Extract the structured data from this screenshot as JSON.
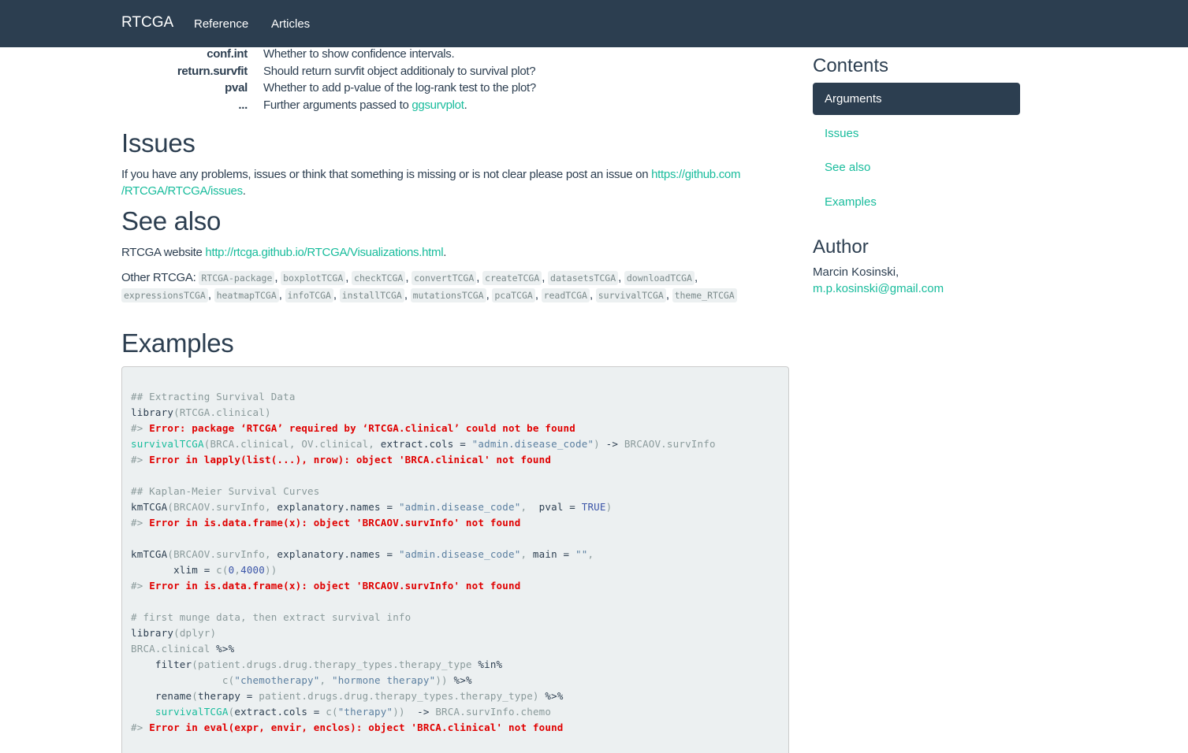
{
  "nav": {
    "brand": "RTCGA",
    "links": [
      "Reference",
      "Articles"
    ]
  },
  "arguments": [
    {
      "name": "conf.int",
      "desc": "Whether to show confidence intervals.",
      "link": ""
    },
    {
      "name": "return.survfit",
      "desc": "Should return survfit object additionaly to survival plot?",
      "link": ""
    },
    {
      "name": "pval",
      "desc": "Whether to add p-value of the log-rank test to the plot?",
      "link": ""
    },
    {
      "name": "...",
      "desc": "Further arguments passed to ",
      "link": "ggsurvplot",
      "after": "."
    }
  ],
  "issues": {
    "title": "Issues",
    "text": "If you have any problems, issues or think that something is missing or is not clear please post an issue on ",
    "link_line1": "https://github.com",
    "link_line2": "/RTCGA/RTCGA/issues",
    "after": "."
  },
  "see_also": {
    "title": "See also",
    "website_label": "RTCGA website ",
    "website_link": "http://rtcga.github.io/RTCGA/Visualizations.html",
    "website_after": ".",
    "other_label": "Other RTCGA: ",
    "other": [
      "RTCGA-package",
      "boxplotTCGA",
      "checkTCGA",
      "convertTCGA",
      "createTCGA",
      "datasetsTCGA",
      "downloadTCGA",
      "expressionsTCGA",
      "heatmapTCGA",
      "infoTCGA",
      "installTCGA",
      "mutationsTCGA",
      "pcaTCGA",
      "readTCGA",
      "survivalTCGA",
      "theme_RTCGA"
    ]
  },
  "examples": {
    "title": "Examples",
    "lines": [
      {
        "parts": [
          {
            "c": "cm",
            "t": "## Extracting Survival Data"
          }
        ]
      },
      {
        "parts": [
          {
            "c": "fn",
            "t": "library"
          },
          {
            "c": "gr",
            "t": "(RTCGA.clinical)"
          }
        ]
      },
      {
        "parts": [
          {
            "c": "gr",
            "t": "#> "
          },
          {
            "c": "err",
            "t": "Error: package ‘RTCGA’ required by ‘RTCGA.clinical’ could not be found"
          }
        ]
      },
      {
        "parts": [
          {
            "c": "grn",
            "t": "survivalTCGA"
          },
          {
            "c": "gr",
            "t": "(BRCA.clinical, OV.clinical, "
          },
          {
            "c": "fn",
            "t": "extract.cols = "
          },
          {
            "c": "str",
            "t": "\"admin.disease_code\""
          },
          {
            "c": "gr",
            "t": ") "
          },
          {
            "c": "fn",
            "t": "-> "
          },
          {
            "c": "gr",
            "t": "BRCAOV.survInfo"
          }
        ]
      },
      {
        "parts": [
          {
            "c": "gr",
            "t": "#> "
          },
          {
            "c": "err",
            "t": "Error in lapply(list(...), nrow): object 'BRCA.clinical' not found"
          }
        ]
      },
      {
        "parts": [
          {
            "c": "fn",
            "t": ""
          }
        ]
      },
      {
        "parts": [
          {
            "c": "cm",
            "t": "## Kaplan-Meier Survival Curves"
          }
        ]
      },
      {
        "parts": [
          {
            "c": "fn",
            "t": "kmTCGA"
          },
          {
            "c": "gr",
            "t": "(BRCAOV.survInfo, "
          },
          {
            "c": "fn",
            "t": "explanatory.names = "
          },
          {
            "c": "str",
            "t": "\"admin.disease_code\""
          },
          {
            "c": "gr",
            "t": ",  "
          },
          {
            "c": "fn",
            "t": "pval = "
          },
          {
            "c": "kw",
            "t": "TRUE"
          },
          {
            "c": "gr",
            "t": ")"
          }
        ]
      },
      {
        "parts": [
          {
            "c": "gr",
            "t": "#> "
          },
          {
            "c": "err",
            "t": "Error in is.data.frame(x): object 'BRCAOV.survInfo' not found"
          }
        ]
      },
      {
        "parts": [
          {
            "c": "fn",
            "t": ""
          }
        ]
      },
      {
        "parts": [
          {
            "c": "fn",
            "t": "kmTCGA"
          },
          {
            "c": "gr",
            "t": "(BRCAOV.survInfo, "
          },
          {
            "c": "fn",
            "t": "explanatory.names = "
          },
          {
            "c": "str",
            "t": "\"admin.disease_code\""
          },
          {
            "c": "gr",
            "t": ", "
          },
          {
            "c": "fn",
            "t": "main = "
          },
          {
            "c": "str",
            "t": "\"\""
          },
          {
            "c": "gr",
            "t": ","
          }
        ]
      },
      {
        "parts": [
          {
            "c": "fn",
            "t": "       xlim = "
          },
          {
            "c": "gr",
            "t": "c("
          },
          {
            "c": "kw",
            "t": "0"
          },
          {
            "c": "gr",
            "t": ","
          },
          {
            "c": "kw",
            "t": "4000"
          },
          {
            "c": "gr",
            "t": "))"
          }
        ]
      },
      {
        "parts": [
          {
            "c": "gr",
            "t": "#> "
          },
          {
            "c": "err",
            "t": "Error in is.data.frame(x): object 'BRCAOV.survInfo' not found"
          }
        ]
      },
      {
        "parts": [
          {
            "c": "fn",
            "t": ""
          }
        ]
      },
      {
        "parts": [
          {
            "c": "cm",
            "t": "# first munge data, then extract survival info"
          }
        ]
      },
      {
        "parts": [
          {
            "c": "fn",
            "t": "library"
          },
          {
            "c": "gr",
            "t": "(dplyr)"
          }
        ]
      },
      {
        "parts": [
          {
            "c": "gr",
            "t": "BRCA.clinical "
          },
          {
            "c": "fn",
            "t": "%>%"
          }
        ]
      },
      {
        "parts": [
          {
            "c": "fn",
            "t": "    filter"
          },
          {
            "c": "gr",
            "t": "(patient.drugs.drug.therapy_types.therapy_type "
          },
          {
            "c": "fn",
            "t": "%in%"
          }
        ]
      },
      {
        "parts": [
          {
            "c": "gr",
            "t": "               c("
          },
          {
            "c": "str",
            "t": "\"chemotherapy\""
          },
          {
            "c": "gr",
            "t": ", "
          },
          {
            "c": "str",
            "t": "\"hormone therapy\""
          },
          {
            "c": "gr",
            "t": ")) "
          },
          {
            "c": "fn",
            "t": "%>%"
          }
        ]
      },
      {
        "parts": [
          {
            "c": "fn",
            "t": "    rename"
          },
          {
            "c": "gr",
            "t": "("
          },
          {
            "c": "fn",
            "t": "therapy = "
          },
          {
            "c": "gr",
            "t": "patient.drugs.drug.therapy_types.therapy_type) "
          },
          {
            "c": "fn",
            "t": "%>%"
          }
        ]
      },
      {
        "parts": [
          {
            "c": "grn",
            "t": "    survivalTCGA"
          },
          {
            "c": "gr",
            "t": "("
          },
          {
            "c": "fn",
            "t": "extract.cols = "
          },
          {
            "c": "gr",
            "t": "c("
          },
          {
            "c": "str",
            "t": "\"therapy\""
          },
          {
            "c": "gr",
            "t": "))  "
          },
          {
            "c": "fn",
            "t": "-> "
          },
          {
            "c": "gr",
            "t": "BRCA.survInfo.chemo"
          }
        ]
      },
      {
        "parts": [
          {
            "c": "gr",
            "t": "#> "
          },
          {
            "c": "err",
            "t": "Error in eval(expr, envir, enclos): object 'BRCA.clinical' not found"
          }
        ]
      }
    ]
  },
  "sidebar": {
    "contents_title": "Contents",
    "toc": [
      "Arguments",
      "Issues",
      "See also",
      "Examples"
    ],
    "author_title": "Author",
    "author_name": "Marcin Kosinski,",
    "author_email": "m.p.kosinski@gmail.com"
  },
  "colors": {
    "navbar": "#2c3e50",
    "link": "#18bc9c",
    "error": "#e00000",
    "code_bg": "#ecf0f1"
  }
}
